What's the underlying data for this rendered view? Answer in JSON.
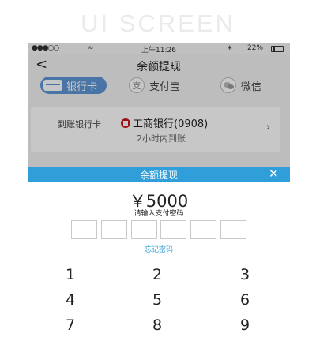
{
  "banner": {
    "title": "UI SCREEN"
  },
  "status_bar": {
    "signal": "●●●○○",
    "wifi": "≈",
    "time": "上午11:26",
    "bluetooth": "∗",
    "battery": "22%"
  },
  "nav": {
    "back": "<",
    "title": "余额提现"
  },
  "tabs": [
    {
      "label": "银行卡",
      "selected": true
    },
    {
      "label": "支付宝",
      "icon_text": "支"
    },
    {
      "label": "微信"
    }
  ],
  "card": {
    "label": "到账银行卡",
    "bank": "工商银行(0908)",
    "sub": "2小时内到账",
    "arrow": "›"
  },
  "sheet": {
    "title": "余额提现",
    "close": "✕",
    "amount": "￥5000",
    "hint": "请输入支付密码",
    "forgot": "忘记密码",
    "password_slots": 6,
    "accent_color": "#2f9ed9"
  },
  "keypad": {
    "keys": [
      "1",
      "2",
      "3",
      "4",
      "5",
      "6",
      "7",
      "8",
      "9"
    ]
  }
}
